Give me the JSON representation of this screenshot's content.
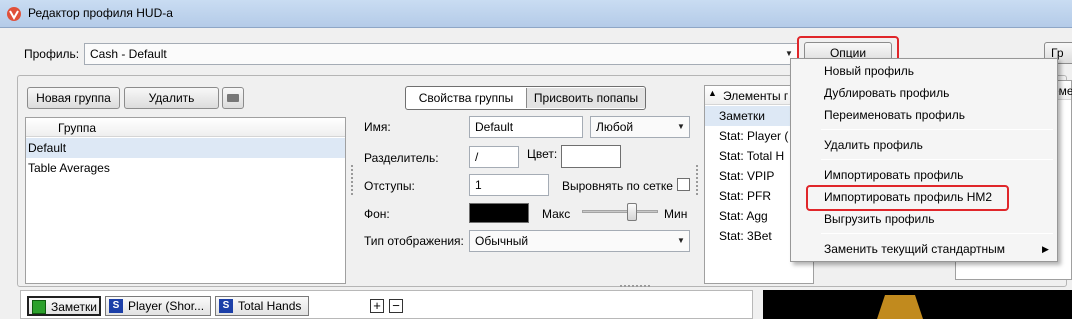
{
  "window": {
    "title": "Редактор профиля HUD-а"
  },
  "profile": {
    "label": "Профиль:",
    "value": "Cash - Default",
    "options_button": "Опции",
    "right_button_partial": "Гр"
  },
  "groups": {
    "new_group_button": "Новая группа",
    "delete_button": "Удалить",
    "column_header": "Группа",
    "items": [
      "Default",
      "Table Averages"
    ]
  },
  "tabs": {
    "group_properties": "Свойства группы",
    "assign_popups": "Присвоить попапы"
  },
  "form": {
    "name_label": "Имя:",
    "name_value": "Default",
    "name_mode": "Любой",
    "separator_label": "Разделитель:",
    "separator_value": "/",
    "color_label": "Цвет:",
    "padding_label": "Отступы:",
    "padding_value": "1",
    "align_grid_label": "Выровнять по сетке",
    "background_label": "Фон:",
    "max_label": "Макс",
    "min_label": "Мин",
    "slider_fraction": 0.68,
    "display_type_label": "Тип отображения:",
    "display_type_value": "Обычный",
    "background_color": "#000000",
    "color_value": "#ffffff"
  },
  "elements": {
    "header": "Элементы г",
    "items": [
      "Заметки",
      "Stat: Player (",
      "Stat: Total H",
      "Stat: VPIP",
      "Stat: PFR",
      "Stat: Agg",
      "Stat: 3Bet"
    ],
    "right_header_partial": "еме"
  },
  "menu": {
    "items": [
      "Новый профиль",
      "Дублировать профиль",
      "Переименовать профиль",
      "Удалить профиль",
      "Импортировать профиль",
      "Импортировать профиль HM2",
      "Выгрузить профиль",
      "Заменить текущий стандартным"
    ]
  },
  "bottom": {
    "chips": [
      {
        "label": "Заметки",
        "icon": "notes-icon"
      },
      {
        "label": "Player (Shor...",
        "icon": "S"
      },
      {
        "label": "Total Hands",
        "icon": "S"
      }
    ],
    "plus": "+",
    "minus": "−"
  },
  "colors": {
    "highlight": "#e0262a",
    "selection": "#dde8f5",
    "stat_icon": "#1c3fa8"
  }
}
